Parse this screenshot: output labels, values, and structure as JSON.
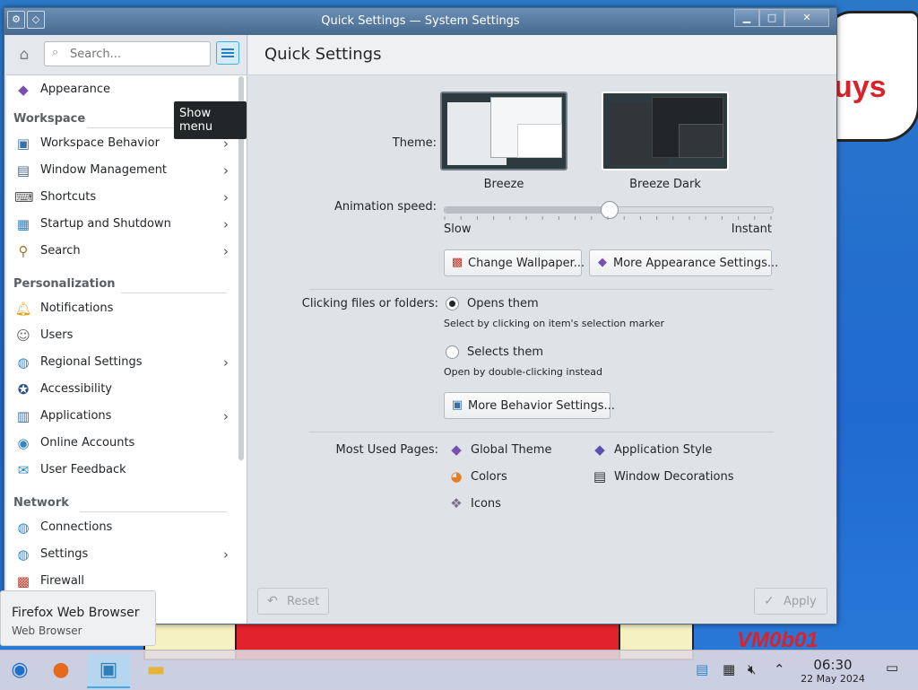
{
  "window": {
    "title": "Quick Settings — System Settings",
    "btn_min": "▁",
    "btn_max": "□",
    "btn_close": "✕"
  },
  "sidebar": {
    "search_placeholder": "Search...",
    "tooltip": "Show menu",
    "top_item": "Appearance",
    "sections": {
      "workspace": "Workspace",
      "personalization": "Personalization",
      "network": "Network"
    },
    "workspace_items": [
      "Workspace Behavior",
      "Window Management",
      "Shortcuts",
      "Startup and Shutdown",
      "Search"
    ],
    "personalization_items": [
      "Notifications",
      "Users",
      "Regional Settings",
      "Accessibility",
      "Applications",
      "Online Accounts",
      "User Feedback"
    ],
    "network_items": [
      "Connections",
      "Settings",
      "Firewall"
    ]
  },
  "main": {
    "title": "Quick Settings",
    "theme_label": "Theme:",
    "themes": [
      "Breeze",
      "Breeze Dark"
    ],
    "animation_label": "Animation speed:",
    "slow": "Slow",
    "instant": "Instant",
    "animation_value": 0.5,
    "change_wallpaper": "Change Wallpaper...",
    "more_appearance": "More Appearance Settings...",
    "clicking_label": "Clicking files or folders:",
    "opens_them": "Opens them",
    "opens_hint": "Select by clicking on item's selection marker",
    "selects_them": "Selects them",
    "selects_hint": "Open by double-clicking instead",
    "more_behavior": "More Behavior Settings...",
    "most_used_label": "Most Used Pages:",
    "most_used": [
      "Global Theme",
      "Application Style",
      "Colors",
      "Window Decorations",
      "Icons"
    ],
    "reset": "Reset",
    "apply": "Apply"
  },
  "desktop": {
    "cloud_text": "uys",
    "vm_text": "VM0b01"
  },
  "taskbar_tooltip": {
    "title": "Firefox Web Browser",
    "subtitle": "Web Browser"
  },
  "clock": {
    "time": "06:30",
    "date": "22 May 2024"
  }
}
